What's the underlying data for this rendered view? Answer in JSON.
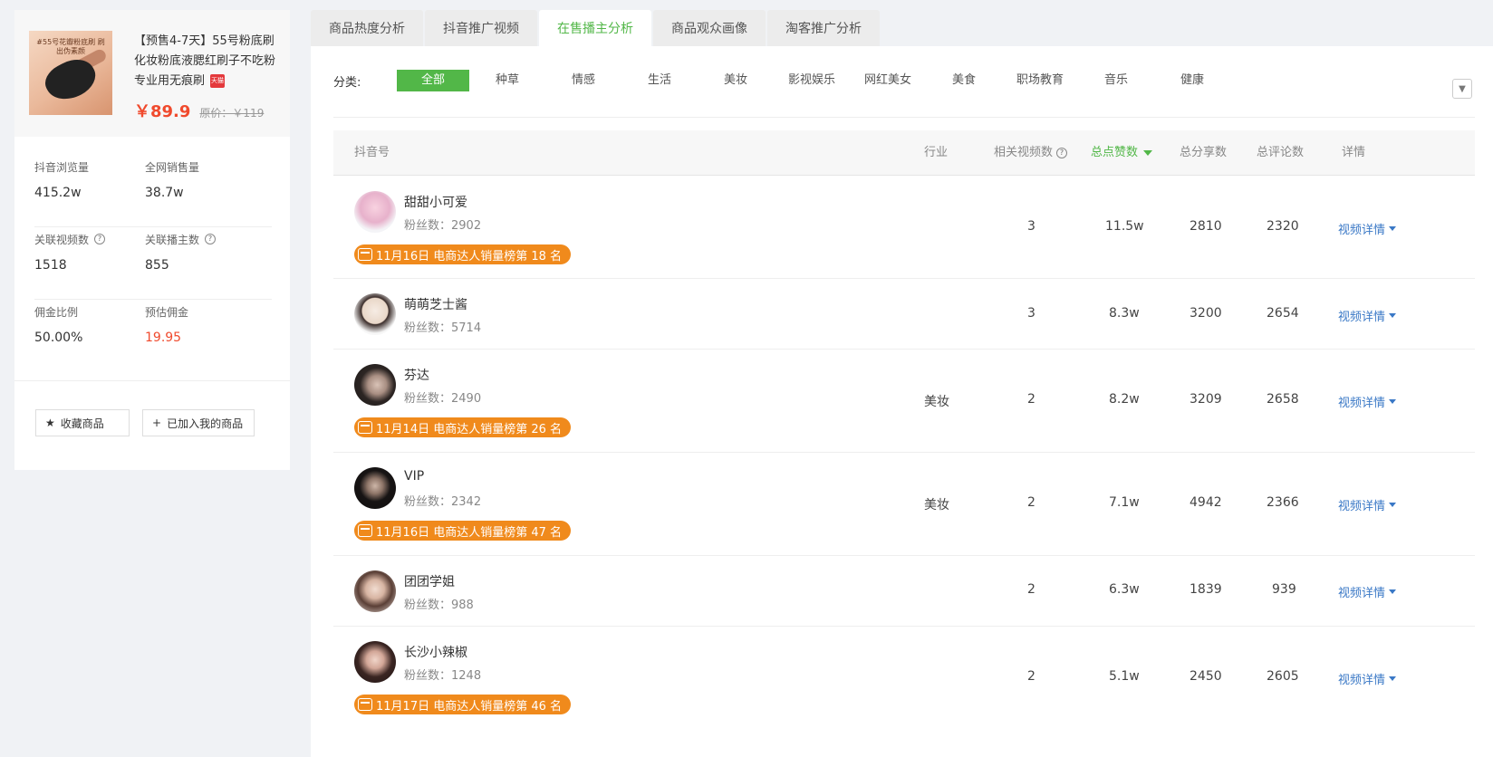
{
  "product": {
    "image_caption": "#55号花瓣粉底刷 刷出伪素颜",
    "title": "【预售4-7天】55号粉底刷化妆粉底液腮红刷子不吃粉专业用无痕刷",
    "store_badge": "天猫",
    "price": "￥89.9",
    "original_price": "原价：￥119"
  },
  "stats": [
    [
      {
        "label": "抖音浏览量",
        "value": "415.2w"
      },
      {
        "label": "全网销售量",
        "value": "38.7w"
      }
    ],
    [
      {
        "label": "关联视频数",
        "value": "1518",
        "help": true
      },
      {
        "label": "关联播主数",
        "value": "855",
        "help": true
      }
    ],
    [
      {
        "label": "佣金比例",
        "value": "50.00%"
      },
      {
        "label": "预估佣金",
        "value": "19.95",
        "highlight": true
      }
    ]
  ],
  "actions": {
    "favorite_label": "收藏商品",
    "added_label": "已加入我的商品"
  },
  "tabs": [
    {
      "label": "商品热度分析",
      "active": false
    },
    {
      "label": "抖音推广视频",
      "active": false
    },
    {
      "label": "在售播主分析",
      "active": true
    },
    {
      "label": "商品观众画像",
      "active": false
    },
    {
      "label": "淘客推广分析",
      "active": false
    }
  ],
  "filter": {
    "label": "分类:",
    "categories": [
      "全部",
      "种草",
      "情感",
      "生活",
      "美妆",
      "影视娱乐",
      "网红美女",
      "美食",
      "职场教育",
      "音乐",
      "健康"
    ],
    "active_index": 0
  },
  "table": {
    "headers": {
      "account": "抖音号",
      "industry": "行业",
      "videos": "相关视频数",
      "likes": "总点赞数",
      "shares": "总分享数",
      "comments": "总评论数",
      "detail": "详情"
    },
    "rows": [
      {
        "name": "甜甜小可爱",
        "fans": "粉丝数：2902",
        "industry": "",
        "videos": "3",
        "likes": "11.5w",
        "shares": "2810",
        "comments": "2320",
        "detail": "视频详情",
        "badge": "11月16日 电商达人销量榜第 18 名",
        "avatar": "avatar-1"
      },
      {
        "name": "萌萌芝士酱",
        "fans": "粉丝数：5714",
        "industry": "",
        "videos": "3",
        "likes": "8.3w",
        "shares": "3200",
        "comments": "2654",
        "detail": "视频详情",
        "badge": "",
        "avatar": "avatar-2"
      },
      {
        "name": "芬达",
        "fans": "粉丝数：2490",
        "industry": "美妆",
        "videos": "2",
        "likes": "8.2w",
        "shares": "3209",
        "comments": "2658",
        "detail": "视频详情",
        "badge": "11月14日 电商达人销量榜第 26 名",
        "avatar": "avatar-3"
      },
      {
        "name": "VIP",
        "fans": "粉丝数：2342",
        "industry": "美妆",
        "videos": "2",
        "likes": "7.1w",
        "shares": "4942",
        "comments": "2366",
        "detail": "视频详情",
        "badge": "11月16日 电商达人销量榜第 47 名",
        "avatar": "avatar-4"
      },
      {
        "name": "团团学姐",
        "fans": "粉丝数：988",
        "industry": "",
        "videos": "2",
        "likes": "6.3w",
        "shares": "1839",
        "comments": "939",
        "detail": "视频详情",
        "badge": "",
        "avatar": "avatar-5"
      },
      {
        "name": "长沙小辣椒",
        "fans": "粉丝数：1248",
        "industry": "",
        "videos": "2",
        "likes": "5.1w",
        "shares": "2450",
        "comments": "2605",
        "detail": "视频详情",
        "badge": "11月17日 电商达人销量榜第 46 名",
        "avatar": "avatar-6"
      }
    ]
  },
  "colors": {
    "accent_green": "#52b748",
    "price_red": "#f04a2d",
    "badge_orange": "#f08a1c",
    "link_blue": "#3a78c6"
  }
}
